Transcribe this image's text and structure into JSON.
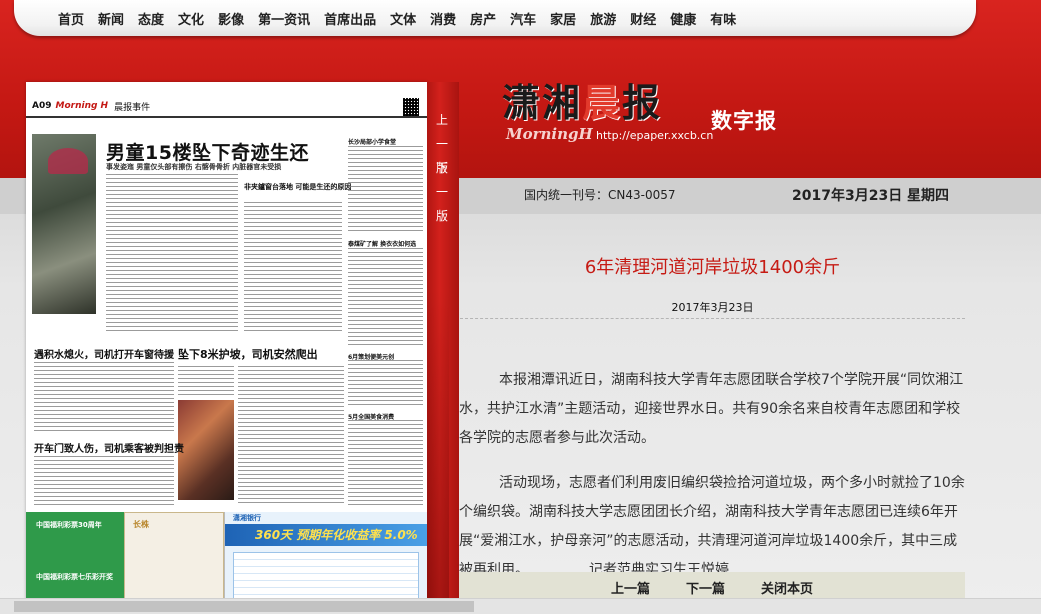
{
  "nav": {
    "items": [
      "首页",
      "新闻",
      "态度",
      "文化",
      "影像",
      "第一资讯",
      "首席出品",
      "文体",
      "消费",
      "房产",
      "汽车",
      "家居",
      "旅游",
      "财经",
      "健康",
      "有味"
    ]
  },
  "paper": {
    "page_no": "A09",
    "paper_logo": "Morning H",
    "section": "晨报事件",
    "headline": "男童15楼坠下奇迹生还",
    "subheadline": "事发姿迤 男童仅头部有擦伤 右髂骨骨折 内脏器官未受损",
    "side_headline": "非夹鑪窗台落地 可能是生还的原因",
    "b1": "遇积水熄火，司机打开车窗待援",
    "b2": "坠下8米护坡，司机安然爬出",
    "b3": "开车门致人伤，司机乘客被判担责",
    "r1": "长沙局部小学食堂",
    "r2": "泰煤矿了解 换衣衣如何选",
    "r3": "6月策划便美元创",
    "r4": "5月全国美食消费",
    "ad1_line1": "中国福利彩票30周年",
    "ad1_line2": "中国福利彩票七乐彩开奖",
    "ad2_title": "长株",
    "ad3_logo": "潇湘银行",
    "ad3_big": "360天 预期年化收益率 5.0%"
  },
  "pagetab": {
    "prev": "上一版",
    "next": "下一版"
  },
  "masthead": {
    "logo_part1": "潇湘",
    "logo_part2": "晨",
    "logo_part3": "报",
    "morning": "MorningH",
    "url": "http://epaper.xxcb.cn",
    "digital": "数字报",
    "issn": "国内统一刊号：CN43-0057",
    "issue_date": "2017年3月23日 星期四"
  },
  "article": {
    "title": "6年清理河道河岸垃圾1400余斤",
    "date": "2017年3月23日",
    "para1": "本报湘潭讯近日，湖南科技大学青年志愿团联合学校7个学院开展“同饮湘江水，共护江水清”主题活动，迎接世界水日。共有90余名来自校青年志愿团和学校各学院的志愿者参与此次活动。",
    "para2": "活动现场，志愿者们利用废旧编织袋捡拾河道垃圾，两个多小时就捡了10余个编织袋。湖南科技大学志愿团团长介绍，湖南科技大学青年志愿团已连续6年开展“爱湘江水，护母亲河”的志愿活动，共清理河道河岸垃圾1400余斤，其中三成被再利用。",
    "reporter": "记者范典实习生王悦婷"
  },
  "bottom": {
    "prev": "上一篇",
    "next": "下一篇",
    "close": "关闭本页"
  },
  "colors": {
    "brand_red": "#c41813",
    "title_red": "#c61b14",
    "bar": "#e2e2d4"
  }
}
